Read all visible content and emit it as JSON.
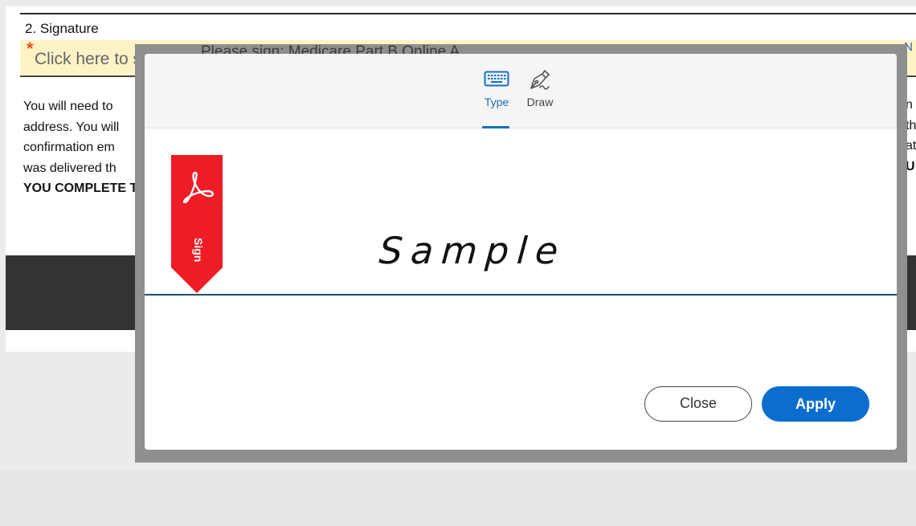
{
  "document": {
    "section_heading": "2. Signature",
    "sign_field": {
      "required_mark": "*",
      "text": "Click here to s"
    },
    "right_edge_letter": "N",
    "paragraph_lines": [
      "You will need to",
      "address. You will",
      "confirmation em",
      "was delivered th",
      "YOU COMPLETE T"
    ],
    "right_fragments": [
      "n",
      "th",
      "at",
      "U"
    ]
  },
  "modal": {
    "frame_title": "Please sign: Medicare Part B Online A",
    "tabs": {
      "type_label": "Type",
      "draw_label": "Draw",
      "active": "type"
    },
    "bookmark_label": "Sign",
    "signature_text": "Sample",
    "buttons": {
      "close_label": "Close",
      "apply_label": "Apply"
    },
    "colors": {
      "accent": "#0b6ecf",
      "bookmark": "#ee1c24",
      "sign_line": "#1d4e6d"
    }
  }
}
